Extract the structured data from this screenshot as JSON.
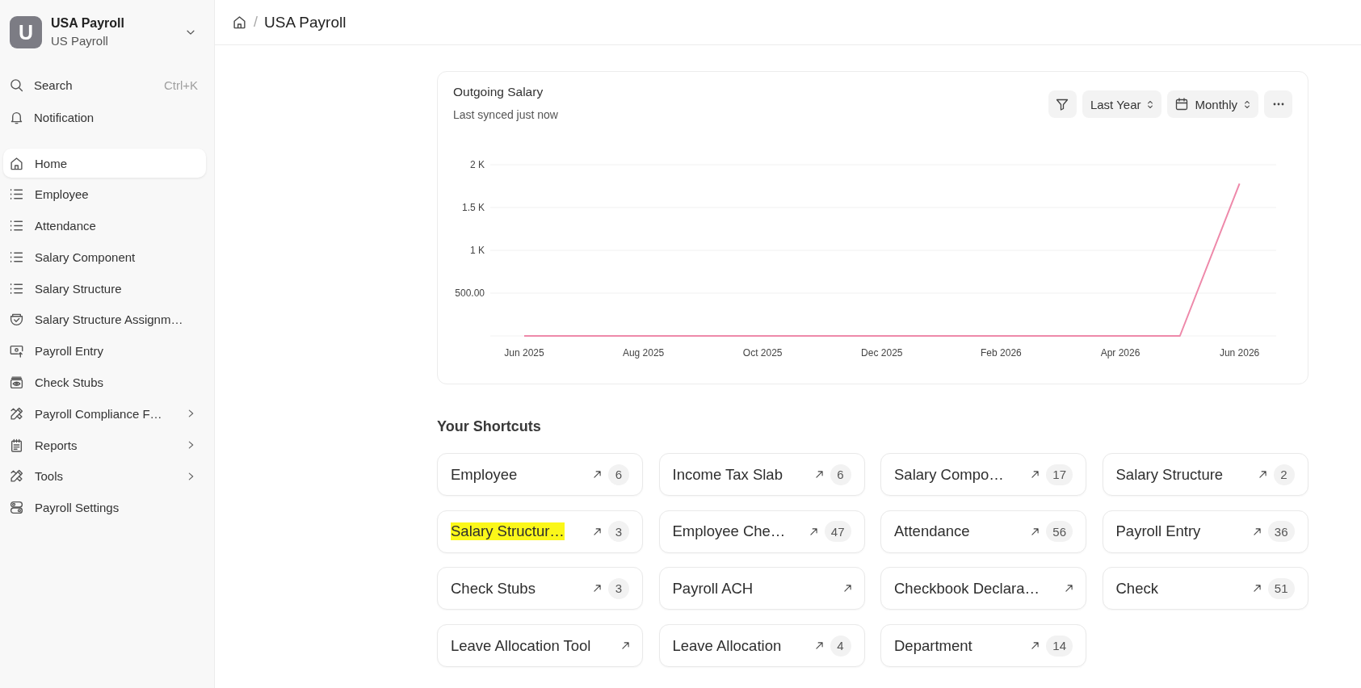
{
  "sidebar": {
    "workspace": {
      "initial": "U",
      "title": "USA Payroll",
      "subtitle": "US Payroll"
    },
    "search": {
      "label": "Search",
      "shortcut": "Ctrl+K"
    },
    "notification": {
      "label": "Notification"
    },
    "items": [
      {
        "kind": "home",
        "label": "Home",
        "selected": true,
        "expandable": false
      },
      {
        "kind": "list",
        "label": "Employee",
        "selected": false,
        "expandable": false
      },
      {
        "kind": "list",
        "label": "Attendance",
        "selected": false,
        "expandable": false
      },
      {
        "kind": "list",
        "label": "Salary Component",
        "selected": false,
        "expandable": false
      },
      {
        "kind": "list",
        "label": "Salary Structure",
        "selected": false,
        "expandable": false
      },
      {
        "kind": "assignment",
        "label": "Salary Structure Assignm…",
        "selected": false,
        "expandable": false
      },
      {
        "kind": "entry",
        "label": "Payroll Entry",
        "selected": false,
        "expandable": false
      },
      {
        "kind": "stubs",
        "label": "Check Stubs",
        "selected": false,
        "expandable": false
      },
      {
        "kind": "tools",
        "label": "Payroll Compliance F…",
        "selected": false,
        "expandable": true
      },
      {
        "kind": "report",
        "label": "Reports",
        "selected": false,
        "expandable": true
      },
      {
        "kind": "tools",
        "label": "Tools",
        "selected": false,
        "expandable": true
      },
      {
        "kind": "settings",
        "label": "Payroll Settings",
        "selected": false,
        "expandable": false
      }
    ]
  },
  "breadcrumb": {
    "separator": "/",
    "current": "USA Payroll"
  },
  "chart": {
    "title": "Outgoing Salary",
    "subtitle": "Last synced just now",
    "controls": [
      {
        "kind": "filter"
      },
      {
        "kind": "select",
        "label": "Last Year"
      },
      {
        "kind": "date-select",
        "label": "Monthly"
      },
      {
        "kind": "more"
      }
    ],
    "chart_data": {
      "type": "line",
      "categories": [
        "Jun 2025",
        null,
        "Aug 2025",
        null,
        "Oct 2025",
        null,
        "Dec 2025",
        null,
        "Feb 2026",
        null,
        "Apr 2026",
        null,
        "Jun 2026"
      ],
      "series": [
        {
          "color": "#ee89aa",
          "values": [
            0,
            0,
            0,
            0,
            0,
            0,
            0,
            0,
            0,
            0,
            0,
            0,
            1780
          ]
        }
      ],
      "ylim": [
        0,
        2000
      ],
      "yticks": [
        {
          "value": 500,
          "label": "500.00"
        },
        {
          "value": 1000,
          "label": "1 K"
        },
        {
          "value": 1500,
          "label": "1.5 K"
        },
        {
          "value": 2000,
          "label": "2 K"
        }
      ],
      "grid": true
    }
  },
  "shortcuts": {
    "title": "Your Shortcuts",
    "items": [
      {
        "label": "Employee",
        "count": "6",
        "highlighted": false
      },
      {
        "label": "Income Tax Slab",
        "count": "6",
        "highlighted": false
      },
      {
        "label": "Salary Compo…",
        "count": "17",
        "highlighted": false
      },
      {
        "label": "Salary Structure",
        "count": "2",
        "highlighted": false
      },
      {
        "label": "Salary Structur…",
        "count": "3",
        "highlighted": true
      },
      {
        "label": "Employee Che…",
        "count": "47",
        "highlighted": false
      },
      {
        "label": "Attendance",
        "count": "56",
        "highlighted": false
      },
      {
        "label": "Payroll Entry",
        "count": "36",
        "highlighted": false
      },
      {
        "label": "Check Stubs",
        "count": "3",
        "highlighted": false
      },
      {
        "label": "Payroll ACH",
        "highlighted": false
      },
      {
        "label": "Checkbook Declara…",
        "highlighted": false
      },
      {
        "label": "Check",
        "count": "51",
        "highlighted": false
      },
      {
        "label": "Leave Allocation Tool",
        "highlighted": false
      },
      {
        "label": "Leave Allocation",
        "count": "4",
        "highlighted": false
      },
      {
        "label": "Department",
        "count": "14",
        "highlighted": false
      }
    ]
  }
}
